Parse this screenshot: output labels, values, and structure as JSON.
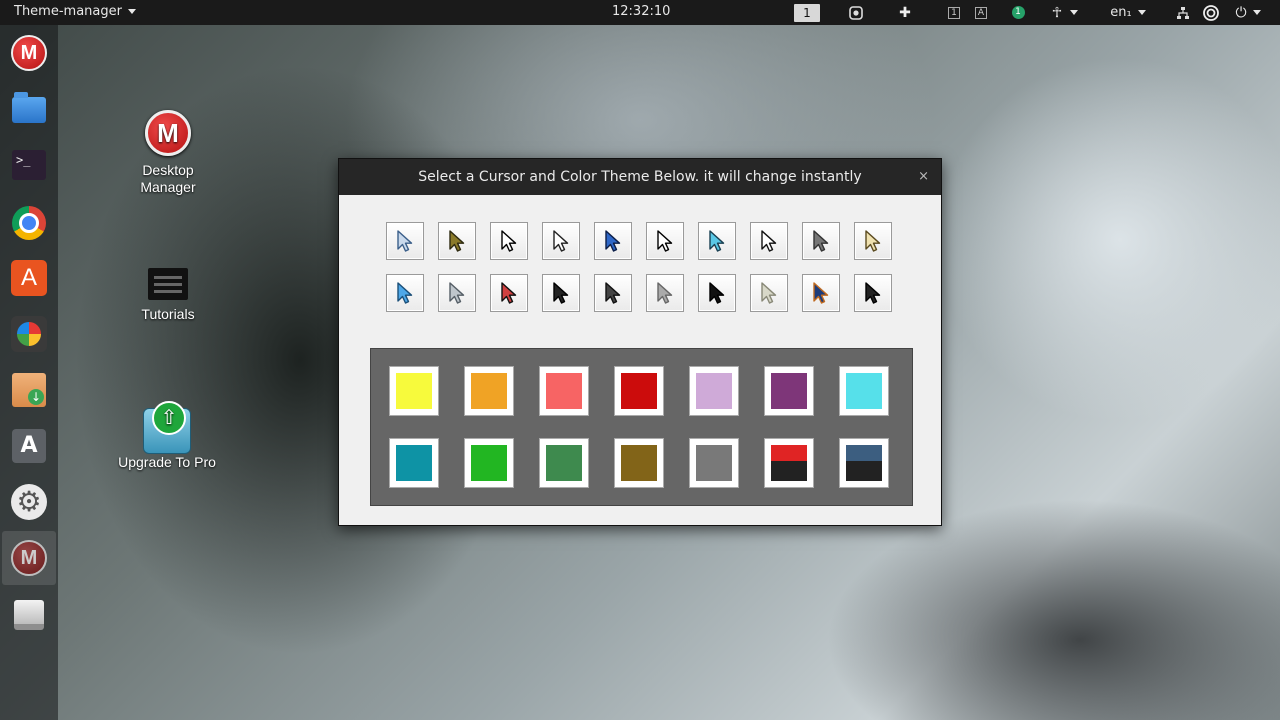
{
  "topbar": {
    "app_name": "Theme-manager",
    "clock": "12:32:10",
    "workspace": "1",
    "kbd_1": "1",
    "kbd_a": "A",
    "badge": "1",
    "language": "en₁"
  },
  "dock": {
    "items": [
      {
        "name": "desktop-manager"
      },
      {
        "name": "files"
      },
      {
        "name": "terminal"
      },
      {
        "name": "chrome"
      },
      {
        "name": "software-center"
      },
      {
        "name": "pinwheel"
      },
      {
        "name": "package-installer"
      },
      {
        "name": "font-viewer"
      },
      {
        "name": "settings"
      },
      {
        "name": "theme-manager"
      },
      {
        "name": "drive"
      }
    ],
    "terminal_prompt": ">_",
    "store_glyph": "A",
    "font_glyph": "A",
    "m_glyph": "M"
  },
  "desktop": {
    "desktop_manager_line1": "Desktop",
    "desktop_manager_line2": "Manager",
    "tutorials": "Tutorials",
    "upgrade": "Upgrade To Pro",
    "m_glyph": "M"
  },
  "dialog": {
    "title": "Select a Cursor and Color Theme Below. it will change instantly",
    "close": "×"
  },
  "cursors": [
    {
      "id": "c1",
      "fill": "#c9d9ec",
      "stroke": "#3b5f8a"
    },
    {
      "id": "c2",
      "fill": "#8a7a2a",
      "stroke": "#2e2a10"
    },
    {
      "id": "c3",
      "fill": "#ffffff",
      "stroke": "#000000"
    },
    {
      "id": "c4",
      "fill": "#ffffff",
      "stroke": "#222222"
    },
    {
      "id": "c5",
      "fill": "#2f68c8",
      "stroke": "#0b1e48"
    },
    {
      "id": "c6",
      "fill": "#ffffff",
      "stroke": "#000000"
    },
    {
      "id": "c7",
      "fill": "#5ac8e6",
      "stroke": "#1a4052"
    },
    {
      "id": "c8",
      "fill": "#ffffff",
      "stroke": "#111111"
    },
    {
      "id": "c9",
      "fill": "#777777",
      "stroke": "#333333"
    },
    {
      "id": "c10",
      "fill": "#f0e2b0",
      "stroke": "#5a4a20"
    },
    {
      "id": "c11",
      "fill": "#4fa8e8",
      "stroke": "#1b4f78"
    },
    {
      "id": "c12",
      "fill": "#bfc6cc",
      "stroke": "#555e66"
    },
    {
      "id": "c13",
      "fill": "#d04040",
      "stroke": "#111111"
    },
    {
      "id": "c14",
      "fill": "#222222",
      "stroke": "#000000"
    },
    {
      "id": "c15",
      "fill": "#444444",
      "stroke": "#111111"
    },
    {
      "id": "c16",
      "fill": "#aaaaaa",
      "stroke": "#666666"
    },
    {
      "id": "c17",
      "fill": "#111111",
      "stroke": "#000000"
    },
    {
      "id": "c18",
      "fill": "#d8d8c8",
      "stroke": "#888877"
    },
    {
      "id": "c19",
      "fill": "#1d3c7a",
      "stroke": "#c06a20"
    },
    {
      "id": "c20",
      "fill": "#222222",
      "stroke": "#000000"
    }
  ],
  "colors": [
    {
      "top": "#f7fa3c",
      "bottom": "#f7fa3c"
    },
    {
      "top": "#f0a325",
      "bottom": "#f0a325"
    },
    {
      "top": "#f76464",
      "bottom": "#f76464"
    },
    {
      "top": "#cc0c0c",
      "bottom": "#cc0c0c"
    },
    {
      "top": "#cfaad8",
      "bottom": "#cfaad8"
    },
    {
      "top": "#7e3679",
      "bottom": "#7e3679"
    },
    {
      "top": "#56e0ea",
      "bottom": "#56e0ea"
    },
    {
      "top": "#0e93a5",
      "bottom": "#0e93a5"
    },
    {
      "top": "#22b622",
      "bottom": "#22b622"
    },
    {
      "top": "#3e8a4e",
      "bottom": "#3e8a4e"
    },
    {
      "top": "#826418",
      "bottom": "#826418"
    },
    {
      "top": "#797979",
      "bottom": "#797979"
    },
    {
      "top": "#e02424",
      "bottom": "#222222"
    },
    {
      "top": "#3c5e80",
      "bottom": "#222222"
    }
  ]
}
